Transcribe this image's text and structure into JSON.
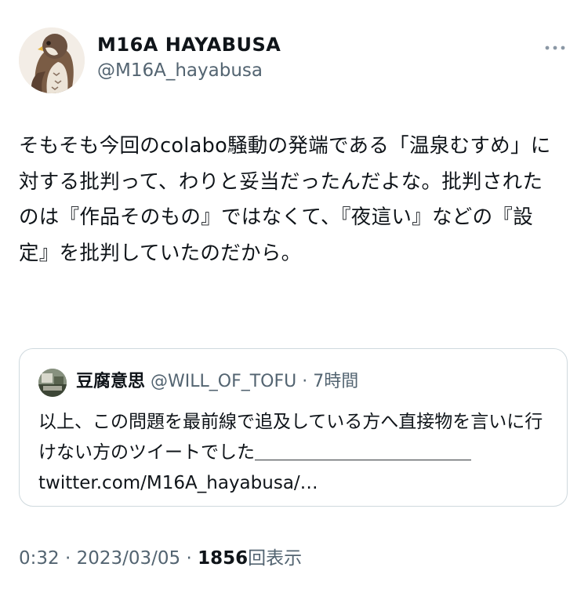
{
  "author": {
    "display_name": "M16A  HAYABUSA",
    "handle": "@M16A_hayabusa",
    "avatar_icon": "hawk-avatar-icon"
  },
  "menu": {
    "more_icon": "more-options-icon"
  },
  "tweet": {
    "text": "そもそも今回のcolabo騒動の発端である「温泉むすめ」に対する批判って、わりと妥当だったんだよな。批判されたのは『作品そのもの』ではなくて、『夜這い』などの『設定』を批判していたのだから。"
  },
  "quote": {
    "display_name": "豆腐意思",
    "handle": "@WILL_OF_TOFU",
    "separator": "·",
    "time": "7時間",
    "text": "以上、この問題を最前線で追及している方へ直接物を言いに行けない方のツイートでした＿＿＿＿＿＿＿＿＿＿＿＿ twitter.com/M16A_hayabusa/…"
  },
  "meta": {
    "time": "0:32",
    "separator": "·",
    "date": "2023/03/05",
    "views_count": "1856",
    "views_label": "回表示"
  },
  "colors": {
    "text": "#0f1419",
    "secondary": "#536471",
    "border": "#cfd9de"
  }
}
